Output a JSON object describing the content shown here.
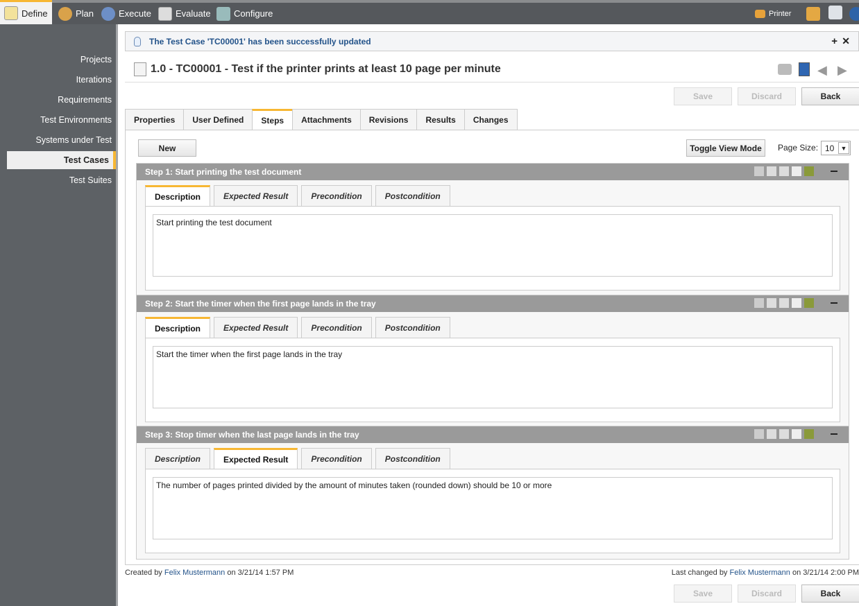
{
  "topnav": [
    {
      "label": "Define",
      "icon": "notepad-icon",
      "active": true
    },
    {
      "label": "Plan",
      "icon": "users-icon"
    },
    {
      "label": "Execute",
      "icon": "gear-icon"
    },
    {
      "label": "Evaluate",
      "icon": "report-icon"
    },
    {
      "label": "Configure",
      "icon": "tools-icon"
    }
  ],
  "topright": {
    "project": "Printer"
  },
  "sidebar": {
    "items": [
      {
        "label": "Projects"
      },
      {
        "label": "Iterations"
      },
      {
        "label": "Requirements"
      },
      {
        "label": "Test Environments"
      },
      {
        "label": "Systems under Test"
      },
      {
        "label": "Test Cases",
        "active": true
      },
      {
        "label": "Test Suites"
      }
    ]
  },
  "notice": {
    "message": "The Test Case 'TC00001' has been successfully updated"
  },
  "title": "1.0 - TC00001 - Test if the printer prints at least 10 page per minute",
  "buttons": {
    "save": "Save",
    "discard": "Discard",
    "back": "Back",
    "new": "New",
    "toggle": "Toggle View Mode"
  },
  "page_size": {
    "label": "Page Size:",
    "value": "10"
  },
  "tabs": [
    {
      "label": "Properties"
    },
    {
      "label": "User Defined"
    },
    {
      "label": "Steps",
      "active": true
    },
    {
      "label": "Attachments"
    },
    {
      "label": "Revisions"
    },
    {
      "label": "Results"
    },
    {
      "label": "Changes"
    }
  ],
  "step_tabs": [
    "Description",
    "Expected Result",
    "Precondition",
    "Postcondition"
  ],
  "steps": [
    {
      "title": "Step 1: Start printing the test document",
      "active_tab": 0,
      "text": "Start printing the test document"
    },
    {
      "title": "Step 2: Start the timer when the first page lands in the tray",
      "active_tab": 0,
      "text": "Start the timer when the first page lands in the tray"
    },
    {
      "title": "Step 3: Stop timer when the last page lands in the tray",
      "active_tab": 1,
      "text": "The number of pages printed divided by the amount of minutes taken (rounded down) should be 10 or more"
    }
  ],
  "footer": {
    "created_prefix": "Created by",
    "created_user": "Felix Mustermann",
    "created_on": "on 3/21/14 1:57 PM",
    "changed_prefix": "Last changed by",
    "changed_user": "Felix Mustermann",
    "changed_on": "on 3/21/14 2:00 PM"
  },
  "colors": {
    "accent": "#f7b733",
    "link": "#23538a",
    "topbar": "#55585c",
    "sidebar": "#5d6165"
  }
}
